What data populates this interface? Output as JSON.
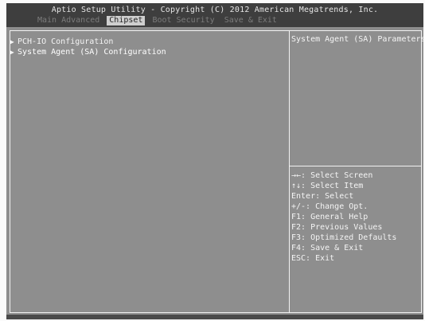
{
  "header": {
    "title": "Aptio Setup Utility - Copyright (C) 2012 American Megatrends, Inc.",
    "tabs": [
      {
        "label": "Main  Advanced"
      },
      {
        "label": "Chipset"
      },
      {
        "label": "Boot  Security"
      },
      {
        "label": "Save & Exit"
      }
    ]
  },
  "menu": {
    "items": [
      {
        "label": "PCH-IO Configuration"
      },
      {
        "label": "System Agent (SA) Configuration"
      }
    ]
  },
  "help": {
    "title": "System Agent (SA) Parameters"
  },
  "keys": [
    "→←: Select Screen",
    "↑↓: Select Item",
    "Enter: Select",
    "+/-: Change Opt.",
    "F1: General Help",
    "F2: Previous Values",
    "F3: Optimized Defaults",
    "F4: Save & Exit",
    "ESC: Exit"
  ]
}
